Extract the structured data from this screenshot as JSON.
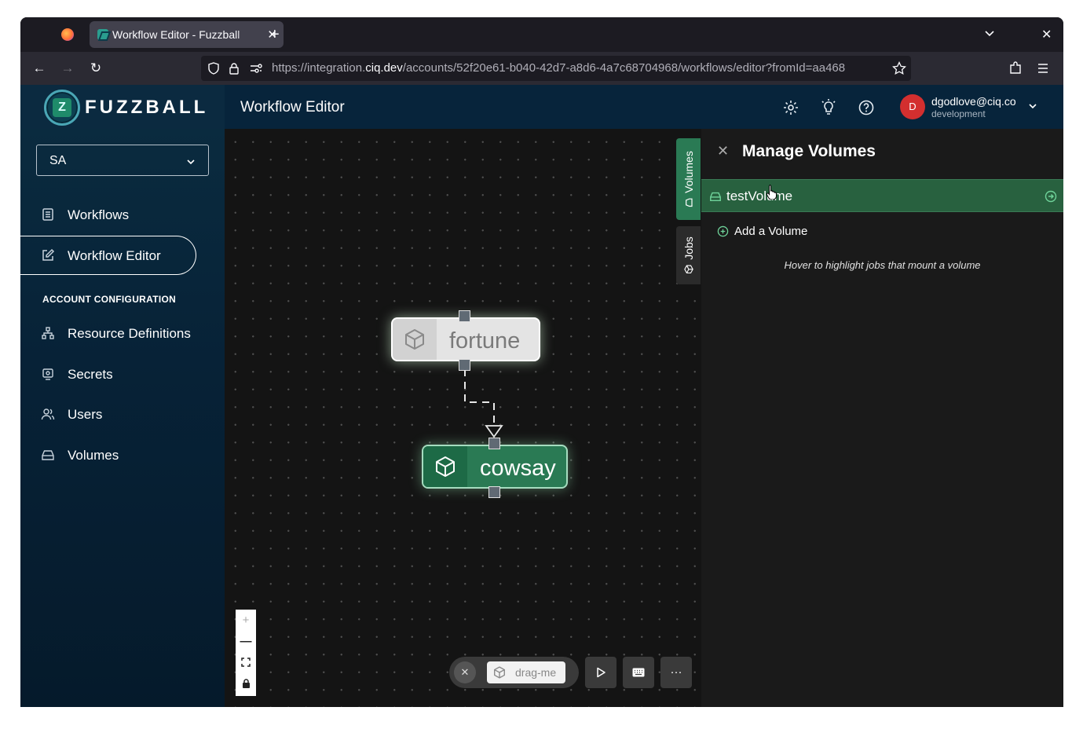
{
  "browser": {
    "tab_title": "Workflow Editor - Fuzzball",
    "url_main": "https://integration.",
    "url_domain": "ciq.dev",
    "url_path": "/accounts/52f20e61-b040-42d7-a8d6-4a7c68704968/workflows/editor?fromId=aa468"
  },
  "app": {
    "brand": "FUZZBALL",
    "page_title": "Workflow Editor",
    "user_email": "dgodlove@ciq.co",
    "user_org": "development",
    "avatar_initial": "D"
  },
  "sidebar": {
    "account_select": "SA",
    "items": [
      {
        "label": "Workflows",
        "icon": "list-icon"
      },
      {
        "label": "Workflow Editor",
        "icon": "edit-icon"
      }
    ],
    "section_title": "ACCOUNT CONFIGURATION",
    "config_items": [
      {
        "label": "Resource Definitions",
        "icon": "hierarchy-icon"
      },
      {
        "label": "Secrets",
        "icon": "secret-icon"
      },
      {
        "label": "Users",
        "icon": "users-icon"
      },
      {
        "label": "Volumes",
        "icon": "drive-icon"
      }
    ]
  },
  "canvas": {
    "nodes": [
      {
        "label": "fortune"
      },
      {
        "label": "cowsay"
      }
    ],
    "drag_label": "drag-me",
    "zoom_controls": [
      "+",
      "—",
      "fit",
      "lock"
    ]
  },
  "side_tabs": {
    "volumes": "Volumes",
    "jobs": "Jobs"
  },
  "panel": {
    "title": "Manage Volumes",
    "volume_name": "testVolume",
    "add_label": "Add a Volume",
    "hint": "Hover to highlight jobs that mount a volume"
  },
  "colors": {
    "accent_green": "#2a7a54",
    "header_bg": "#07243b",
    "avatar_red": "#d32f2f"
  }
}
